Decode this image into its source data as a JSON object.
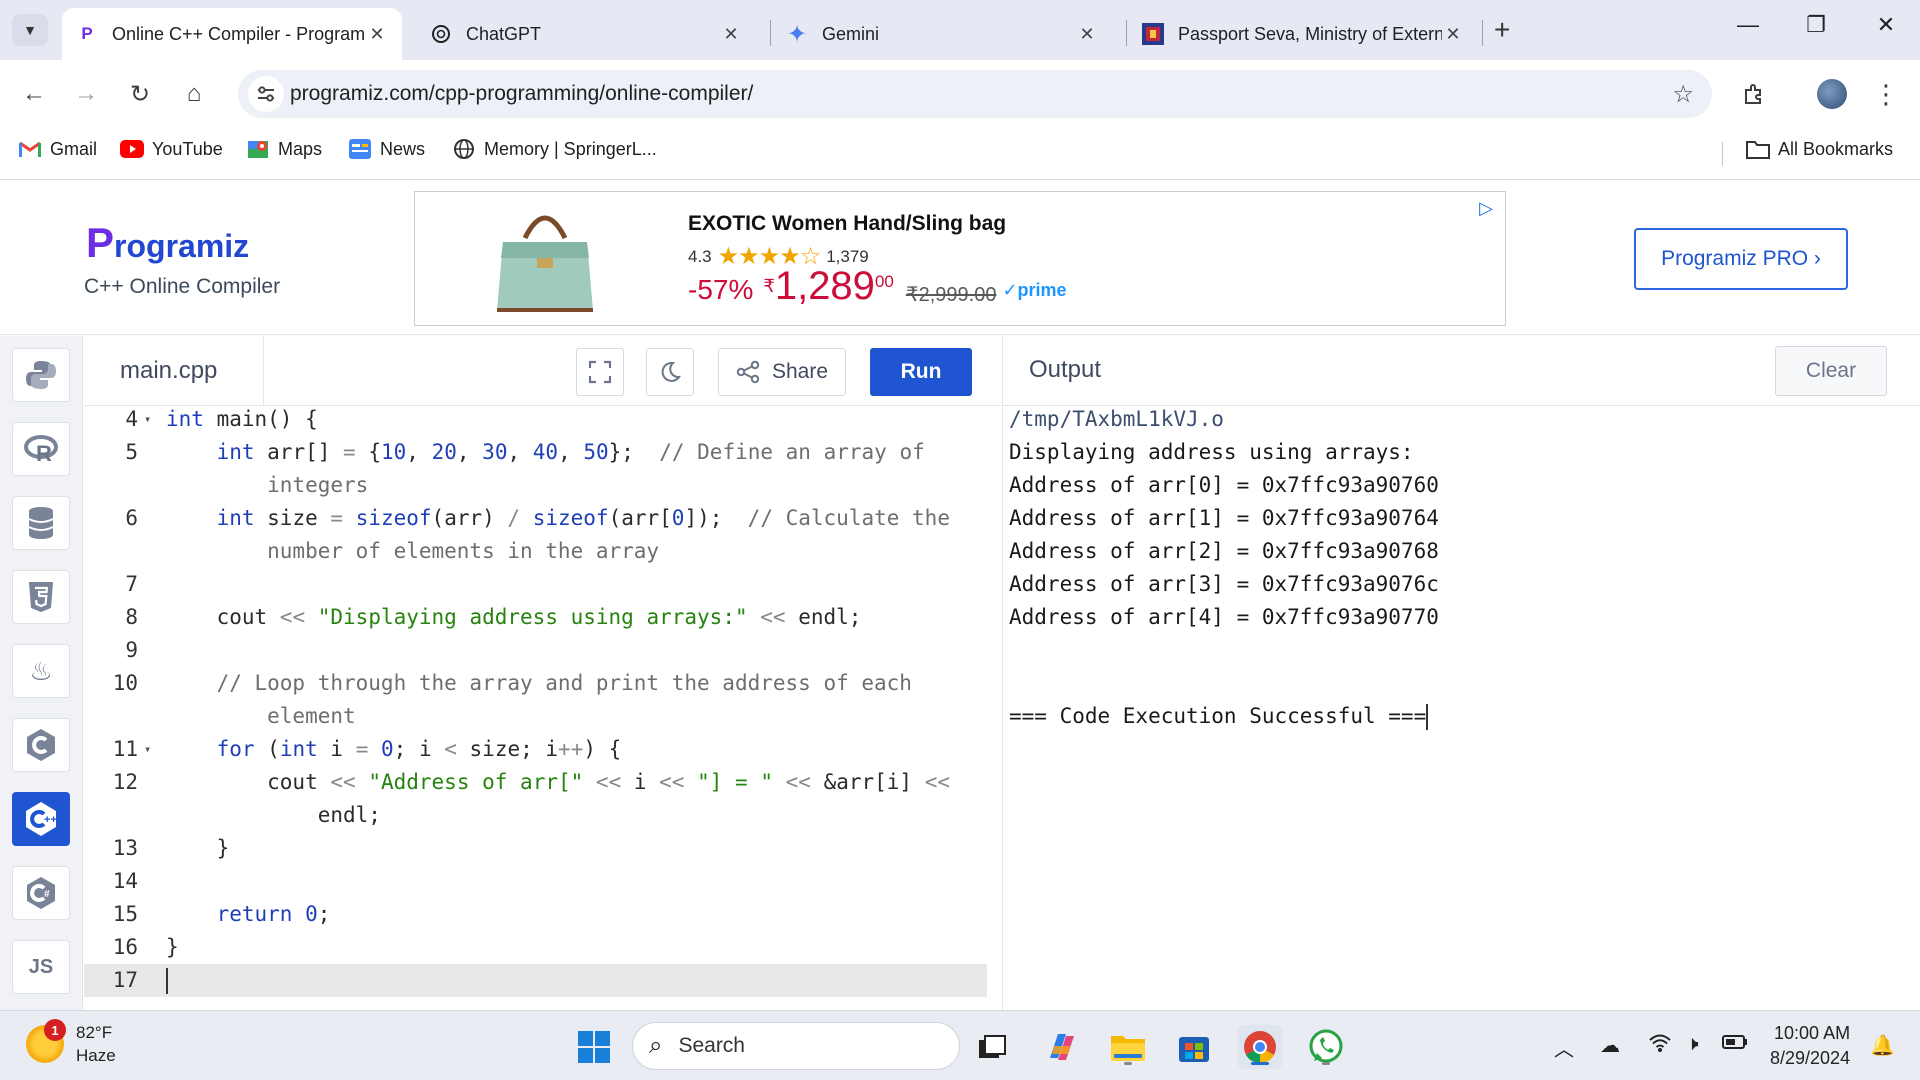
{
  "browser": {
    "tabs": [
      {
        "title": "Online C++ Compiler - Programiz",
        "favicon": "P",
        "active": true
      },
      {
        "title": "ChatGPT",
        "favicon": "chatgpt-icon",
        "active": false
      },
      {
        "title": "Gemini",
        "favicon": "gemini-icon",
        "active": false
      },
      {
        "title": "Passport Seva, Ministry of External Affairs",
        "favicon": "passport-seva-icon",
        "active": false
      }
    ],
    "url": "programiz.com/cpp-programming/online-compiler/",
    "bookmarks": [
      {
        "label": "Gmail",
        "icon": "gmail-icon"
      },
      {
        "label": "YouTube",
        "icon": "youtube-icon"
      },
      {
        "label": "Maps",
        "icon": "maps-icon"
      },
      {
        "label": "News",
        "icon": "news-icon"
      },
      {
        "label": "Memory | SpringerL...",
        "icon": "globe-icon"
      }
    ],
    "all_bookmarks": "All Bookmarks"
  },
  "header": {
    "logo": "rogramiz",
    "logo_mark": "P",
    "subtitle": "C++ Online Compiler",
    "pro_button": "Programiz PRO ›"
  },
  "ad": {
    "title": "EXOTIC Women Hand/Sling bag",
    "rating": "4.3",
    "stars": "★★★★☆",
    "reviews": "1,379",
    "discount": "-57%",
    "currency": "₹",
    "price": "1,289",
    "paise": "00",
    "mrp": "₹2,999.00",
    "prime": "✓prime"
  },
  "sidebar": {
    "languages": [
      {
        "name": "python",
        "glyph": "🐍"
      },
      {
        "name": "r",
        "glyph": "R"
      },
      {
        "name": "sql",
        "glyph": "⛁"
      },
      {
        "name": "html",
        "glyph": "5"
      },
      {
        "name": "java",
        "glyph": "☕"
      },
      {
        "name": "c",
        "glyph": "C"
      },
      {
        "name": "cpp",
        "glyph": "C+"
      },
      {
        "name": "csharp",
        "glyph": "C#"
      },
      {
        "name": "js",
        "glyph": "JS"
      }
    ],
    "active": "cpp"
  },
  "editor": {
    "filename": "main.cpp",
    "share_label": "Share",
    "run_label": "Run",
    "lines": [
      {
        "n": "4",
        "fold": true,
        "tokens": [
          [
            "kw",
            "int"
          ],
          [
            "plain",
            " main() {"
          ]
        ]
      },
      {
        "n": "5",
        "tokens": [
          [
            "plain",
            "    "
          ],
          [
            "kw",
            "int"
          ],
          [
            "plain",
            " arr[] "
          ],
          [
            "op",
            "="
          ],
          [
            "plain",
            " {"
          ],
          [
            "num",
            "10"
          ],
          [
            "plain",
            ", "
          ],
          [
            "num",
            "20"
          ],
          [
            "plain",
            ", "
          ],
          [
            "num",
            "30"
          ],
          [
            "plain",
            ", "
          ],
          [
            "num",
            "40"
          ],
          [
            "plain",
            ", "
          ],
          [
            "num",
            "50"
          ],
          [
            "plain",
            "};  "
          ],
          [
            "cm",
            "// Define an array of"
          ]
        ]
      },
      {
        "n": "",
        "tokens": [
          [
            "cm",
            "        integers"
          ]
        ]
      },
      {
        "n": "6",
        "tokens": [
          [
            "plain",
            "    "
          ],
          [
            "kw",
            "int"
          ],
          [
            "plain",
            " size "
          ],
          [
            "op",
            "="
          ],
          [
            "plain",
            " "
          ],
          [
            "kw",
            "sizeof"
          ],
          [
            "plain",
            "(arr) "
          ],
          [
            "op",
            "/"
          ],
          [
            "plain",
            " "
          ],
          [
            "kw",
            "sizeof"
          ],
          [
            "plain",
            "(arr["
          ],
          [
            "num",
            "0"
          ],
          [
            "plain",
            "]);  "
          ],
          [
            "cm",
            "// Calculate the"
          ]
        ]
      },
      {
        "n": "",
        "tokens": [
          [
            "cm",
            "        number of elements in the array"
          ]
        ]
      },
      {
        "n": "7",
        "tokens": []
      },
      {
        "n": "8",
        "tokens": [
          [
            "plain",
            "    cout "
          ],
          [
            "op",
            "<<"
          ],
          [
            "plain",
            " "
          ],
          [
            "str",
            "\"Displaying address using arrays:\""
          ],
          [
            "plain",
            " "
          ],
          [
            "op",
            "<<"
          ],
          [
            "plain",
            " endl;"
          ]
        ]
      },
      {
        "n": "9",
        "tokens": []
      },
      {
        "n": "10",
        "tokens": [
          [
            "cm",
            "    // Loop through the array and print the address of each"
          ]
        ]
      },
      {
        "n": "",
        "tokens": [
          [
            "cm",
            "        element"
          ]
        ]
      },
      {
        "n": "11",
        "fold": true,
        "tokens": [
          [
            "plain",
            "    "
          ],
          [
            "kw",
            "for"
          ],
          [
            "plain",
            " ("
          ],
          [
            "kw",
            "int"
          ],
          [
            "plain",
            " i "
          ],
          [
            "op",
            "="
          ],
          [
            "plain",
            " "
          ],
          [
            "num",
            "0"
          ],
          [
            "plain",
            "; i "
          ],
          [
            "op",
            "<"
          ],
          [
            "plain",
            " size; i"
          ],
          [
            "op",
            "++"
          ],
          [
            "plain",
            ") {"
          ]
        ]
      },
      {
        "n": "12",
        "tokens": [
          [
            "plain",
            "        cout "
          ],
          [
            "op",
            "<<"
          ],
          [
            "plain",
            " "
          ],
          [
            "str",
            "\"Address of arr[\""
          ],
          [
            "plain",
            " "
          ],
          [
            "op",
            "<<"
          ],
          [
            "plain",
            " i "
          ],
          [
            "op",
            "<<"
          ],
          [
            "plain",
            " "
          ],
          [
            "str",
            "\"] = \""
          ],
          [
            "plain",
            " "
          ],
          [
            "op",
            "<<"
          ],
          [
            "plain",
            " &arr[i] "
          ],
          [
            "op",
            "<<"
          ]
        ]
      },
      {
        "n": "",
        "tokens": [
          [
            "plain",
            "            endl;"
          ]
        ]
      },
      {
        "n": "13",
        "tokens": [
          [
            "plain",
            "    }"
          ]
        ]
      },
      {
        "n": "14",
        "tokens": []
      },
      {
        "n": "15",
        "tokens": [
          [
            "plain",
            "    "
          ],
          [
            "kw",
            "return"
          ],
          [
            "plain",
            " "
          ],
          [
            "num",
            "0"
          ],
          [
            "plain",
            ";"
          ]
        ]
      },
      {
        "n": "16",
        "tokens": [
          [
            "plain",
            "}"
          ]
        ]
      },
      {
        "n": "17",
        "current": true,
        "tokens": []
      }
    ]
  },
  "output": {
    "title": "Output",
    "clear_label": "Clear",
    "lines": [
      "/tmp/TAxbmL1kVJ.o",
      "Displaying address using arrays:",
      "Address of arr[0] = 0x7ffc93a90760",
      "Address of arr[1] = 0x7ffc93a90764",
      "Address of arr[2] = 0x7ffc93a90768",
      "Address of arr[3] = 0x7ffc93a9076c",
      "Address of arr[4] = 0x7ffc93a90770",
      "",
      "",
      "=== Code Execution Successful ==="
    ]
  },
  "taskbar": {
    "weather_temp": "82°F",
    "weather_desc": "Haze",
    "weather_badge": "1",
    "search_placeholder": "Search",
    "time": "10:00 AM",
    "date": "8/29/2024"
  }
}
